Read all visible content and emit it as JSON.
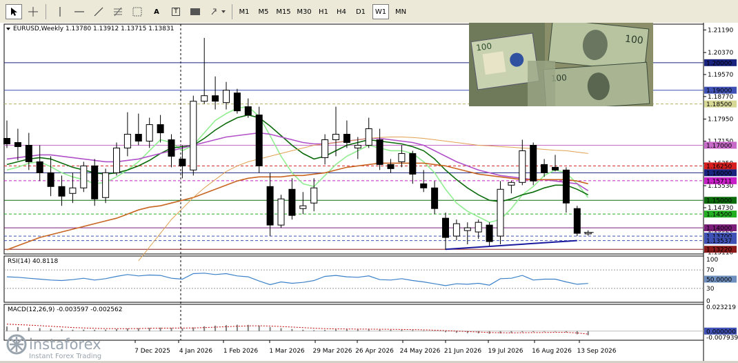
{
  "toolbar": {
    "tools": [
      {
        "name": "cursor-icon"
      },
      {
        "name": "crosshair-icon"
      },
      {
        "name": "vertical-line-icon"
      },
      {
        "name": "horizontal-line-icon"
      },
      {
        "name": "trendline-icon"
      },
      {
        "name": "fibonacci-icon"
      },
      {
        "name": "grid-icon"
      },
      {
        "name": "text-icon"
      },
      {
        "name": "text-label-icon"
      },
      {
        "name": "rectangle-icon"
      },
      {
        "name": "arrows-icon"
      }
    ],
    "text_tool_label": "A",
    "text_label_tool_label": "T",
    "timeframes": [
      "M1",
      "M5",
      "M15",
      "M30",
      "H1",
      "H4",
      "D1",
      "W1",
      "MN"
    ],
    "selected_timeframe": "W1"
  },
  "chart_header": {
    "symbol_info": "EURUSD,Weekly  1.13780 1.13912 1.13715 1.13831"
  },
  "price_axis": {
    "ticks": [
      "1.21190",
      "1.20370",
      "1.19570",
      "1.18770",
      "1.17950",
      "1.17150",
      "1.16350",
      "1.15530",
      "1.14730",
      "1.13920",
      "1.13110"
    ]
  },
  "price_tags": [
    {
      "text": "1.20000",
      "bg": "#1a237e",
      "fg": "#ffffff"
    },
    {
      "text": "1.19000",
      "bg": "#3f51b5",
      "fg": "#ffffff"
    },
    {
      "text": "1.18500",
      "bg": "#d8d896",
      "fg": "#000000"
    },
    {
      "text": "1.17000",
      "bg": "#c86ac8",
      "fg": "#ffffff"
    },
    {
      "text": "1.16250",
      "bg": "#d81e1e",
      "fg": "#ffffff"
    },
    {
      "text": "1.16000",
      "bg": "#1a237e",
      "fg": "#ffffff"
    },
    {
      "text": "1.15711",
      "bg": "#c81ec8",
      "fg": "#ffffff"
    },
    {
      "text": "1.15000",
      "bg": "#0b6b0b",
      "fg": "#ffffff"
    },
    {
      "text": "1.14500",
      "bg": "#22b022",
      "fg": "#ffffff"
    },
    {
      "text": "1.14000",
      "bg": "#7a1e7a",
      "fg": "#ffffff"
    },
    {
      "text": "1.13700",
      "bg": "#3f51b5",
      "fg": "#ffffff"
    },
    {
      "text": "1.13537",
      "bg": "#3f51b5",
      "fg": "#ffffff"
    },
    {
      "text": "1.13220",
      "bg": "#8b1a1a",
      "fg": "#ffffff"
    }
  ],
  "time_axis": {
    "labels": [
      "7 Dec 2025",
      "4 Jan 2026",
      "1 Feb 2026",
      "1 Mar 2026",
      "29 Mar 2026",
      "26 Apr 2026",
      "24 May 2026",
      "21 Jun 2026",
      "19 Jul 2026",
      "16 Aug 2026",
      "13 Sep 2026"
    ]
  },
  "rsi": {
    "title": "RSI(14) 40.8118",
    "ticks": [
      "100",
      "70",
      "30",
      "0"
    ],
    "tag": {
      "text": "50.0000",
      "bg": "#6f8fbf",
      "fg": "#ffffff"
    }
  },
  "macd": {
    "title": "MACD(12,26,9) -0.003597 -0.002562",
    "ticks": [
      "0.023219",
      "-0.007939"
    ],
    "tag": {
      "text": "0.000000",
      "bg": "#3f51b5",
      "fg": "#ffffff"
    }
  },
  "logo": {
    "brand": "instaforex",
    "tagline": "Instant Forex Trading"
  },
  "colors": {
    "bull": "#ffffff",
    "bear": "#000000",
    "ma_fast": "#90ee90",
    "ma_green": "#0b6b0b",
    "ma_purple": "#b050c8",
    "ma_orange": "#c86420",
    "ma_tan": "#e0a050",
    "ma_blue": "#1a1aa0",
    "rsi_line": "#3a80c8"
  },
  "chart_data": {
    "type": "candlestick",
    "symbol": "EURUSD",
    "timeframe": "Weekly",
    "last_ohlc": {
      "open": 1.1378,
      "high": 1.13912,
      "low": 1.13715,
      "close": 1.13831
    },
    "candles": [
      [
        1.1725,
        1.179,
        1.169,
        1.1705
      ],
      [
        1.171,
        1.176,
        1.1645,
        1.1695
      ],
      [
        1.17,
        1.1745,
        1.161,
        1.164
      ],
      [
        1.164,
        1.17,
        1.157,
        1.16
      ],
      [
        1.16,
        1.166,
        1.1515,
        1.155
      ],
      [
        1.155,
        1.159,
        1.148,
        1.1515
      ],
      [
        1.1525,
        1.16,
        1.149,
        1.1545
      ],
      [
        1.1545,
        1.164,
        1.153,
        1.1625
      ],
      [
        1.1625,
        1.165,
        1.148,
        1.1505
      ],
      [
        1.151,
        1.1615,
        1.149,
        1.16
      ],
      [
        1.16,
        1.171,
        1.159,
        1.169
      ],
      [
        1.169,
        1.182,
        1.166,
        1.174
      ],
      [
        1.174,
        1.1815,
        1.17,
        1.1715
      ],
      [
        1.1715,
        1.18,
        1.169,
        1.1775
      ],
      [
        1.1775,
        1.181,
        1.171,
        1.1745
      ],
      [
        1.172,
        1.174,
        1.162,
        1.166
      ],
      [
        1.165,
        1.17,
        1.158,
        1.1625
      ],
      [
        1.161,
        1.188,
        1.159,
        1.186
      ],
      [
        1.186,
        1.209,
        1.185,
        1.188
      ],
      [
        1.188,
        1.195,
        1.183,
        1.186
      ],
      [
        1.1855,
        1.193,
        1.183,
        1.19
      ],
      [
        1.189,
        1.1905,
        1.1815,
        1.1825
      ],
      [
        1.184,
        1.187,
        1.18,
        1.181
      ],
      [
        1.181,
        1.184,
        1.16,
        1.1625
      ],
      [
        1.155,
        1.16,
        1.137,
        1.141
      ],
      [
        1.141,
        1.152,
        1.14,
        1.1505
      ],
      [
        1.154,
        1.158,
        1.143,
        1.1445
      ],
      [
        1.147,
        1.153,
        1.145,
        1.148
      ],
      [
        1.149,
        1.158,
        1.146,
        1.1545
      ],
      [
        1.1655,
        1.174,
        1.163,
        1.172
      ],
      [
        1.172,
        1.184,
        1.166,
        1.174
      ],
      [
        1.174,
        1.179,
        1.169,
        1.171
      ],
      [
        1.169,
        1.173,
        1.165,
        1.17
      ],
      [
        1.17,
        1.18,
        1.169,
        1.176
      ],
      [
        1.172,
        1.176,
        1.161,
        1.163
      ],
      [
        1.163,
        1.165,
        1.16,
        1.1615
      ],
      [
        1.164,
        1.17,
        1.162,
        1.167
      ],
      [
        1.167,
        1.168,
        1.156,
        1.1595
      ],
      [
        1.156,
        1.161,
        1.153,
        1.1545
      ],
      [
        1.1545,
        1.157,
        1.145,
        1.147
      ],
      [
        1.1435,
        1.1455,
        1.132,
        1.1365
      ],
      [
        1.137,
        1.143,
        1.1355,
        1.1415
      ],
      [
        1.139,
        1.142,
        1.134,
        1.14
      ],
      [
        1.1385,
        1.143,
        1.136,
        1.142
      ],
      [
        1.141,
        1.142,
        1.1335,
        1.135
      ],
      [
        1.137,
        1.157,
        1.134,
        1.154
      ],
      [
        1.1555,
        1.157,
        1.1525,
        1.1565
      ],
      [
        1.1565,
        1.172,
        1.1555,
        1.168
      ],
      [
        1.17,
        1.171,
        1.1555,
        1.157
      ],
      [
        1.163,
        1.165,
        1.1585,
        1.16
      ],
      [
        1.162,
        1.1665,
        1.1605,
        1.161
      ],
      [
        1.161,
        1.162,
        1.1455,
        1.149
      ],
      [
        1.147,
        1.148,
        1.137,
        1.138
      ],
      [
        1.1378,
        1.1391,
        1.13715,
        1.1383
      ]
    ],
    "moving_averages": [
      {
        "color": "#90ee90",
        "values": [
          1.161,
          1.162,
          1.1635,
          1.164,
          1.1622,
          1.16,
          1.1585,
          1.1575,
          1.156,
          1.1565,
          1.1585,
          1.161,
          1.164,
          1.168,
          1.172,
          1.171,
          1.168,
          1.17,
          1.1745,
          1.179,
          1.1815,
          1.1835,
          1.184,
          1.1805,
          1.1735,
          1.166,
          1.16,
          1.156,
          1.155,
          1.159,
          1.163,
          1.166,
          1.168,
          1.17,
          1.169,
          1.168,
          1.168,
          1.167,
          1.164,
          1.16,
          1.154,
          1.149,
          1.146,
          1.144,
          1.142,
          1.143,
          1.147,
          1.152,
          1.155,
          1.159,
          1.161,
          1.16,
          1.156,
          1.151
        ]
      },
      {
        "color": "#0b6b0b",
        "values": [
          1.163,
          1.164,
          1.165,
          1.1655,
          1.165,
          1.1635,
          1.162,
          1.161,
          1.16,
          1.1595,
          1.16,
          1.161,
          1.1625,
          1.1645,
          1.167,
          1.169,
          1.1695,
          1.17,
          1.1725,
          1.1755,
          1.178,
          1.18,
          1.181,
          1.18,
          1.177,
          1.1735,
          1.17,
          1.167,
          1.165,
          1.166,
          1.168,
          1.17,
          1.171,
          1.172,
          1.1715,
          1.171,
          1.1705,
          1.1695,
          1.168,
          1.165,
          1.161,
          1.1575,
          1.1545,
          1.152,
          1.15,
          1.1495,
          1.1505,
          1.152,
          1.153,
          1.1545,
          1.1555,
          1.1555,
          1.154,
          1.152
        ]
      },
      {
        "color": "#b050c8",
        "values": [
          1.165,
          1.1655,
          1.166,
          1.1665,
          1.1665,
          1.166,
          1.1655,
          1.165,
          1.1645,
          1.164,
          1.164,
          1.1645,
          1.165,
          1.166,
          1.167,
          1.168,
          1.169,
          1.17,
          1.171,
          1.172,
          1.173,
          1.1735,
          1.174,
          1.1745,
          1.174,
          1.173,
          1.172,
          1.171,
          1.1705,
          1.1705,
          1.171,
          1.1715,
          1.172,
          1.1725,
          1.1725,
          1.172,
          1.1715,
          1.171,
          1.17,
          1.168,
          1.166,
          1.164,
          1.1625,
          1.161,
          1.16,
          1.159,
          1.1585,
          1.158,
          1.1575,
          1.1575,
          1.157,
          1.1565,
          1.156,
          1.1535
        ]
      },
      {
        "color": "#c86420",
        "values": [
          1.132,
          1.1335,
          1.135,
          1.1365,
          1.1375,
          1.1385,
          1.1395,
          1.1405,
          1.1415,
          1.1425,
          1.1435,
          1.145,
          1.1465,
          1.1475,
          1.148,
          1.149,
          1.15,
          1.151,
          1.1525,
          1.154,
          1.1555,
          1.157,
          1.158,
          1.1585,
          1.1585,
          1.1585,
          1.159,
          1.159,
          1.1595,
          1.16,
          1.161,
          1.162,
          1.1625,
          1.163,
          1.1635,
          1.1635,
          1.1635,
          1.1635,
          1.1635,
          1.163,
          1.1625,
          1.1615,
          1.1605,
          1.1595,
          1.159,
          1.1585,
          1.158,
          1.1575,
          1.1575,
          1.1575,
          1.1575,
          1.1575,
          1.157,
          1.156
        ]
      },
      {
        "color": "#e0a050",
        "values": [
          null,
          null,
          null,
          null,
          null,
          null,
          null,
          null,
          null,
          null,
          null,
          null,
          1.128,
          1.133,
          1.138,
          1.143,
          1.147,
          1.151,
          1.1545,
          1.1575,
          1.1605,
          1.1625,
          1.164,
          1.165,
          1.166,
          1.167,
          1.168,
          1.169,
          1.17,
          1.1705,
          1.171,
          1.1715,
          1.172,
          1.1725,
          1.1728,
          1.173,
          1.173,
          1.1728,
          1.1725,
          1.172,
          1.1715,
          1.171,
          1.1705,
          1.17,
          1.1698,
          1.1695,
          1.1693,
          1.169,
          1.1688,
          1.1685,
          1.1682,
          1.168,
          1.1675,
          1.167
        ]
      }
    ],
    "lower_trend": [
      [
        40,
        1.1322
      ],
      [
        52,
        1.13537
      ]
    ],
    "horizontal_levels": [
      {
        "price": 1.2,
        "color": "#1a237e",
        "style": "solid"
      },
      {
        "price": 1.19,
        "color": "#3f51b5",
        "style": "solid"
      },
      {
        "price": 1.185,
        "color": "#b0b060",
        "style": "dash"
      },
      {
        "price": 1.17,
        "color": "#c86ac8",
        "style": "solid"
      },
      {
        "price": 1.1625,
        "color": "#d81e1e",
        "style": "dash"
      },
      {
        "price": 1.16,
        "color": "#1a237e",
        "style": "solid"
      },
      {
        "price": 1.15711,
        "color": "#c81ec8",
        "style": "dash"
      },
      {
        "price": 1.15,
        "color": "#0b6b0b",
        "style": "solid"
      },
      {
        "price": 1.145,
        "color": "#22b022",
        "style": "dash"
      },
      {
        "price": 1.14,
        "color": "#7a1e7a",
        "style": "solid"
      },
      {
        "price": 1.137,
        "color": "#3f51b5",
        "style": "dash"
      },
      {
        "price": 1.13537,
        "color": "#3f51b5",
        "style": "dash"
      },
      {
        "price": 1.1322,
        "color": "#8b1a1a",
        "style": "solid"
      }
    ],
    "rsi_values": [
      55,
      54,
      52,
      50,
      48,
      47,
      49,
      52,
      48,
      51,
      56,
      60,
      57,
      59,
      58,
      52,
      50,
      62,
      63,
      60,
      62,
      57,
      55,
      46,
      38,
      44,
      41,
      43,
      47,
      56,
      58,
      55,
      54,
      57,
      49,
      48,
      51,
      47,
      44,
      40,
      36,
      40,
      39,
      41,
      37,
      51,
      52,
      58,
      48,
      50,
      50,
      44,
      39,
      40.8
    ],
    "macd_histogram": [
      0.004,
      0.0035,
      0.003,
      0.0025,
      0.002,
      0.0015,
      0.0012,
      0.0013,
      0.0012,
      0.0013,
      0.0018,
      0.0022,
      0.0025,
      0.0028,
      0.003,
      0.0028,
      0.0025,
      0.0032,
      0.0042,
      0.0048,
      0.0052,
      0.0055,
      0.0054,
      0.0048,
      0.0035,
      0.0025,
      0.0018,
      0.0012,
      0.0008,
      0.001,
      0.0015,
      0.0016,
      0.0015,
      0.0016,
      0.0012,
      0.001,
      0.001,
      0.0008,
      0.0004,
      -0.0002,
      -0.001,
      -0.0015,
      -0.0018,
      -0.002,
      -0.0024,
      -0.002,
      -0.0016,
      -0.001,
      -0.0008,
      -0.0006,
      -0.0005,
      -0.001,
      -0.0028,
      -0.0036
    ],
    "macd_signal": [
      0.006,
      0.0056,
      0.0052,
      0.0047,
      0.0042,
      0.0036,
      0.0031,
      0.0027,
      0.0024,
      0.0022,
      0.0021,
      0.0021,
      0.0022,
      0.0024,
      0.0025,
      0.0026,
      0.0026,
      0.0027,
      0.003,
      0.0034,
      0.0038,
      0.0042,
      0.0045,
      0.0046,
      0.0044,
      0.004,
      0.0035,
      0.003,
      0.0025,
      0.0021,
      0.0019,
      0.0018,
      0.0017,
      0.0017,
      0.0016,
      0.0015,
      0.0014,
      0.0013,
      0.0011,
      0.0008,
      0.0004,
      0,
      -0.0004,
      -0.0008,
      -0.0012,
      -0.0014,
      -0.0015,
      -0.0014,
      -0.0013,
      -0.0012,
      -0.0011,
      -0.0011,
      -0.0016,
      -0.0026
    ]
  }
}
